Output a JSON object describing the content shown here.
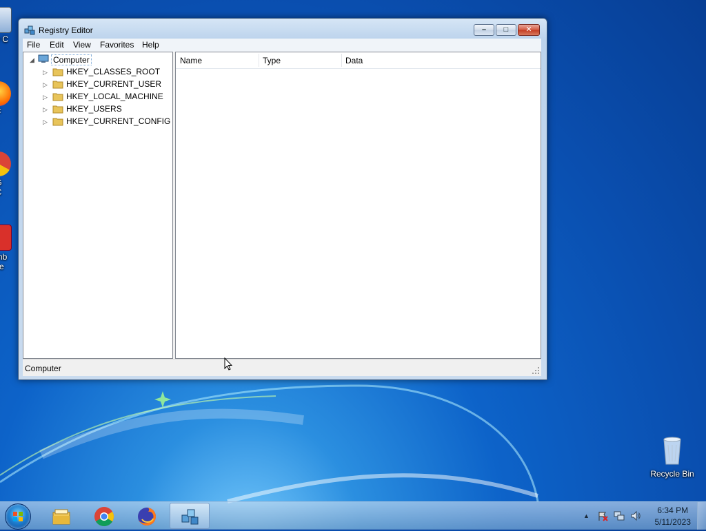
{
  "desktop": {
    "icons": [
      {
        "label": "My C",
        "icon": "computer-icon"
      },
      {
        "label": "F",
        "icon": "firefox-shortcut-icon"
      },
      {
        "label": "G\nC",
        "icon": "chrome-shortcut-icon"
      },
      {
        "label": "Emb\nDe",
        "icon": "app-shortcut-icon"
      },
      {
        "label": "Recycle Bin",
        "icon": "recycle-bin-icon"
      }
    ]
  },
  "window": {
    "title": "Registry Editor",
    "controls": {
      "minimize": "–",
      "maximize": "□",
      "close": "✕"
    },
    "menu": [
      "File",
      "Edit",
      "View",
      "Favorites",
      "Help"
    ],
    "tree": {
      "root": "Computer",
      "root_expander": "◢",
      "child_expander": "▷",
      "children": [
        "HKEY_CLASSES_ROOT",
        "HKEY_CURRENT_USER",
        "HKEY_LOCAL_MACHINE",
        "HKEY_USERS",
        "HKEY_CURRENT_CONFIG"
      ]
    },
    "list": {
      "columns": [
        "Name",
        "Type",
        "Data"
      ]
    },
    "status": "Computer"
  },
  "taskbar": {
    "items": [
      {
        "name": "windows-explorer",
        "active": false
      },
      {
        "name": "google-chrome",
        "active": false
      },
      {
        "name": "firefox",
        "active": false
      },
      {
        "name": "registry-editor",
        "active": true
      }
    ],
    "tray": {
      "show_hidden": "▲",
      "time": "6:34 PM",
      "date": "5/11/2023"
    }
  },
  "colors": {
    "accent": "#0d63c9",
    "folder": "#e8c45a",
    "selection_border": "#7aa7d6"
  }
}
